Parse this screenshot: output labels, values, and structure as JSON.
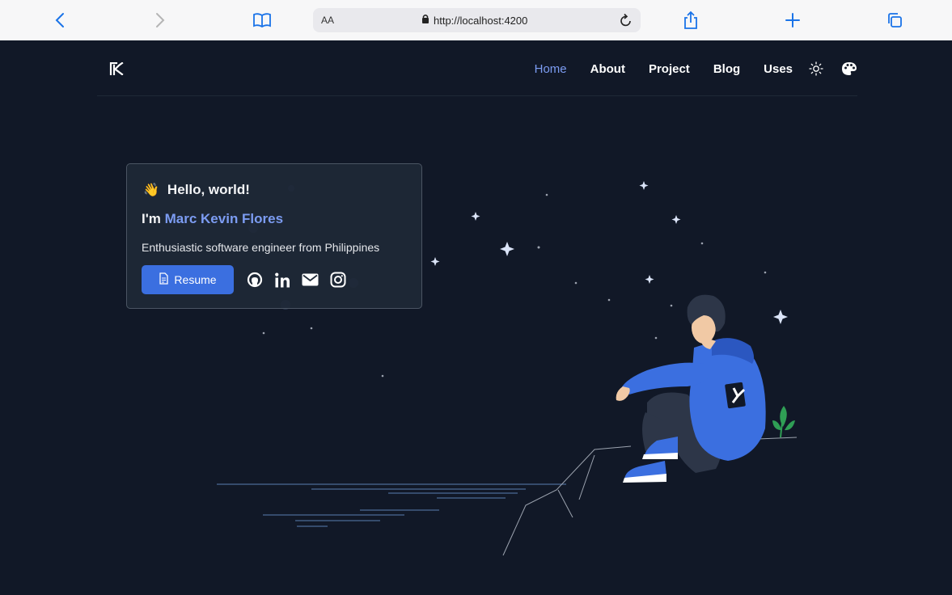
{
  "browser": {
    "text_size_label": "AA",
    "url": "http://localhost:4200",
    "icons": [
      "back-icon",
      "forward-icon",
      "bookmarks-icon",
      "lock-icon",
      "reload-icon",
      "share-icon",
      "new-tab-icon",
      "tabs-icon"
    ]
  },
  "nav": {
    "links": [
      "Home",
      "About",
      "Project",
      "Blog",
      "Uses"
    ],
    "active": "Home",
    "icons": [
      "sun-icon",
      "palette-icon"
    ]
  },
  "hero": {
    "greeting": "Hello, world!",
    "greeting_emoji": "👋",
    "intro_prefix": "I'm",
    "name": "Marc Kevin Flores",
    "tagline": "Enthusiastic software engineer from Philippines",
    "resume_label": "Resume",
    "social_icons": [
      "github-icon",
      "linkedin-icon",
      "email-icon",
      "instagram-icon"
    ]
  },
  "colors": {
    "background": "#111827",
    "accent": "#7c9cf2",
    "button": "#3b6fe0",
    "hoodie": "#3b6fe0"
  }
}
